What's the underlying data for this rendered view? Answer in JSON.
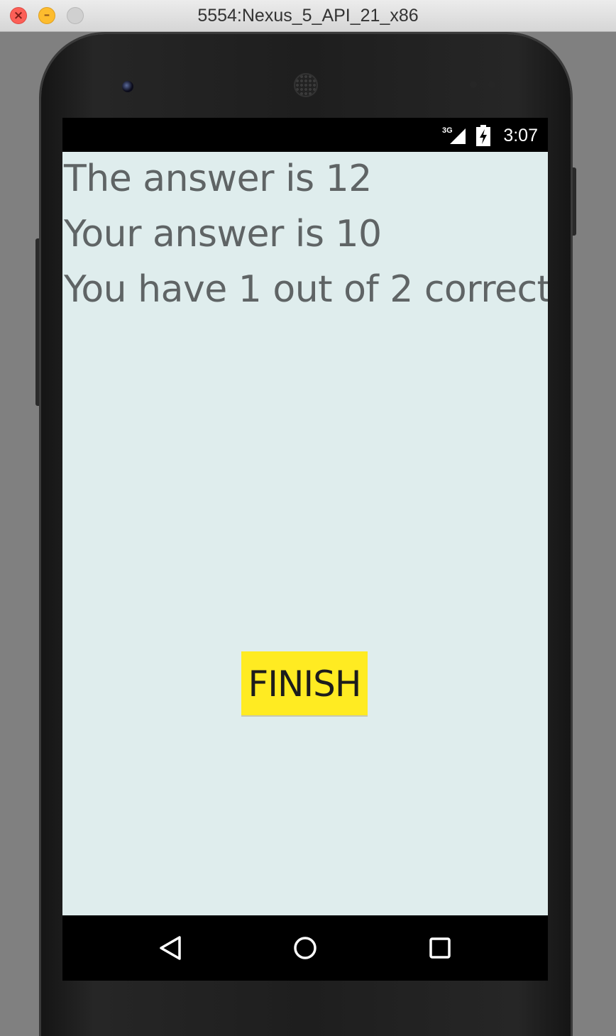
{
  "window": {
    "title": "5554:Nexus_5_API_21_x86",
    "close_glyph": "×",
    "minimize_glyph": "–"
  },
  "status_bar": {
    "network": "3G",
    "time": "3:07"
  },
  "results": {
    "line1": "The answer is 12",
    "line2": "Your answer is 10",
    "line3": "You have 1 out of 2 correct"
  },
  "finish_button": {
    "label": "FINISH",
    "color": "#ffeb22"
  },
  "nav_bar": {
    "icons": [
      "back-icon",
      "home-icon",
      "recents-icon"
    ]
  },
  "colors": {
    "screen_background": "#dfeded",
    "text": "#5f6465"
  }
}
